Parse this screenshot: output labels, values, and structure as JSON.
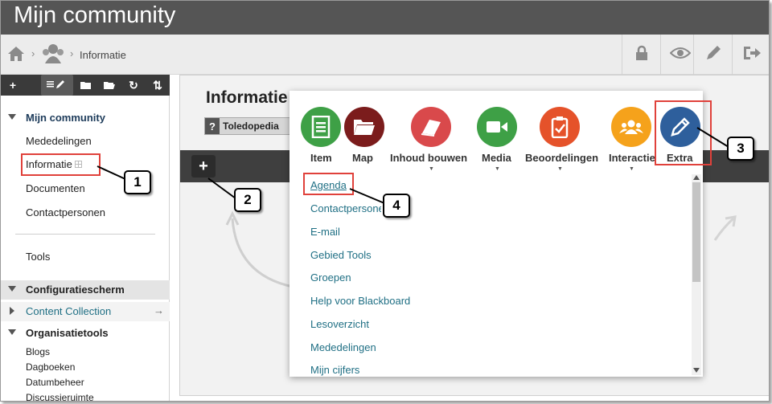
{
  "header": {
    "title": "Mijn community"
  },
  "breadcrumb": {
    "current": "Informatie",
    "separator": "›"
  },
  "sidebar": {
    "section_main": "Mijn community",
    "links": [
      "Mededelingen",
      "Informatie",
      "Documenten",
      "Contactpersonen"
    ],
    "tools": "Tools",
    "config_title": "Configuratiescherm",
    "content_collection": "Content Collection",
    "org_title": "Organisatietools",
    "org_links": [
      "Blogs",
      "Dagboeken",
      "Datumbeheer",
      "Discussieruimte"
    ]
  },
  "content": {
    "title": "Informatie",
    "help_q": "?",
    "help_label": "Toledopedia",
    "plus": "+"
  },
  "menu": {
    "items": [
      {
        "label": "Item",
        "icon": "document-icon",
        "color": "#3ea046"
      },
      {
        "label": "Map",
        "icon": "folder-icon",
        "color": "#7b1c1c"
      },
      {
        "label": "Inhoud bouwen",
        "icon": "book-icon",
        "color": "#d9494b"
      },
      {
        "label": "Media",
        "icon": "video-icon",
        "color": "#3ea046"
      },
      {
        "label": "Beoordelingen",
        "icon": "clipboard-icon",
        "color": "#e5522a"
      },
      {
        "label": "Interactie",
        "icon": "users-icon",
        "color": "#f5a21b"
      },
      {
        "label": "Extra",
        "icon": "pencil-icon",
        "color": "#2e5f9c"
      }
    ],
    "list": [
      "Agenda",
      "Contactpersonen",
      "E-mail",
      "Gebied Tools",
      "Groepen",
      "Help voor Blackboard",
      "Lesoverzicht",
      "Mededelingen",
      "Mijn cijfers"
    ]
  },
  "callouts": [
    "1",
    "2",
    "3",
    "4"
  ],
  "colors": {
    "highlight": "#e0413b",
    "link": "#1f6f84"
  }
}
